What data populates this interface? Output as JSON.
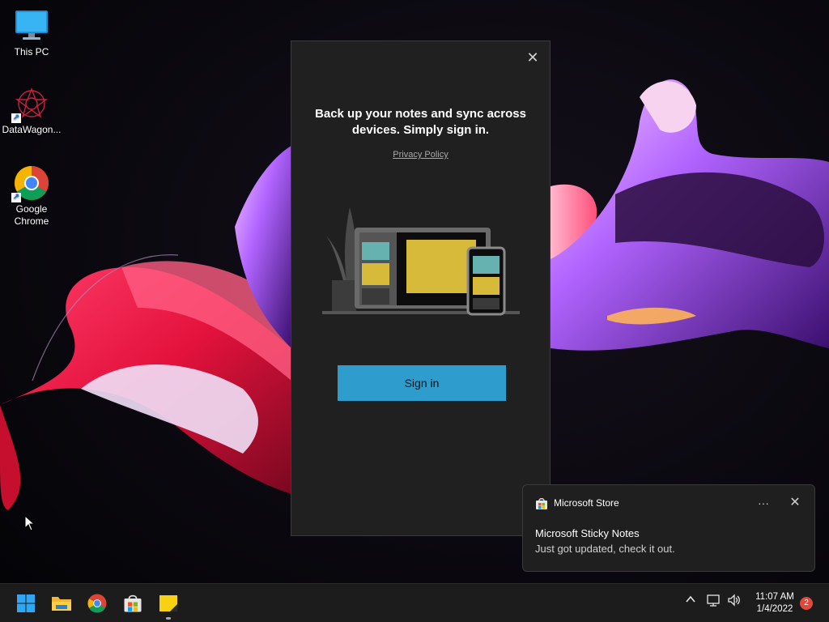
{
  "desktop": {
    "icons": [
      {
        "label": "This PC"
      },
      {
        "label": "DataWagon..."
      },
      {
        "label": "Google Chrome"
      }
    ]
  },
  "sticky_notes_window": {
    "heading": "Back up your notes and sync across devices. Simply sign in.",
    "privacy_link": "Privacy Policy",
    "sign_in_label": "Sign in",
    "close_icon": "close-icon"
  },
  "toast": {
    "app_name": "Microsoft Store",
    "title": "Microsoft Sticky Notes",
    "body": "Just got updated, check it out.",
    "more_label": "···",
    "close_label": "✕"
  },
  "taskbar": {
    "apps": [
      "start-icon",
      "file-explorer-icon",
      "chrome-icon",
      "microsoft-store-icon",
      "sticky-notes-icon"
    ],
    "time": "11:07 AM",
    "date": "1/4/2022",
    "notification_count": "2"
  },
  "colors": {
    "accent": "#2e9ccd",
    "window_bg": "#202020",
    "taskbar_bg": "#1c1c1c",
    "badge": "#e04a3a"
  }
}
